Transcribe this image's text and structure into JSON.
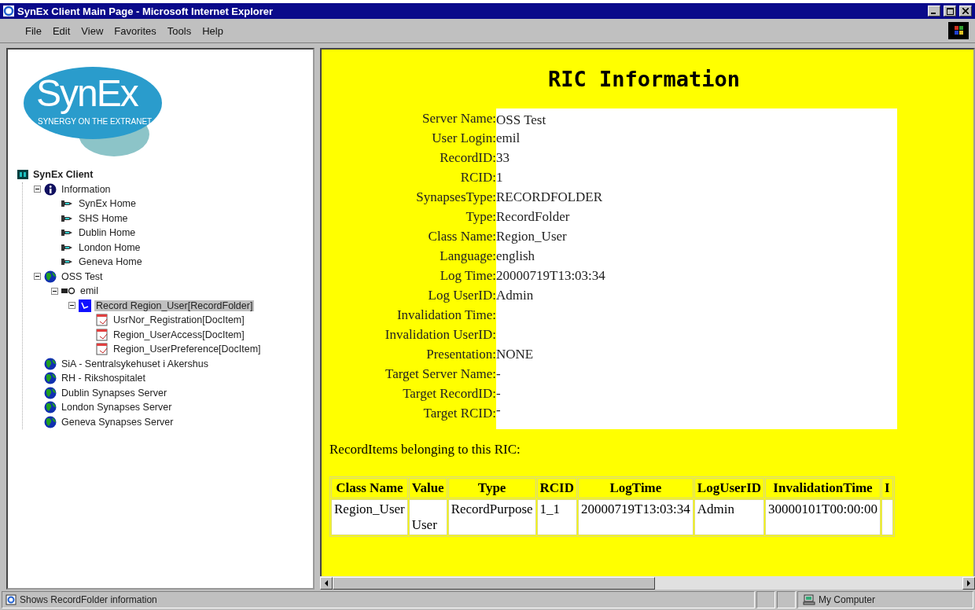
{
  "window": {
    "title": "SynEx Client Main Page - Microsoft Internet Explorer"
  },
  "menu": [
    "File",
    "Edit",
    "View",
    "Favorites",
    "Tools",
    "Help"
  ],
  "logo": {
    "name": "SynEx",
    "tagline": "SYNERGY ON THE EXTRANET"
  },
  "tree": {
    "label": "SynEx Client",
    "kind": "app",
    "children": [
      {
        "label": "Information",
        "kind": "info",
        "expanded": true,
        "selected": false,
        "children": [
          {
            "label": "SynEx Home",
            "kind": "link",
            "selected": false
          },
          {
            "label": "SHS Home",
            "kind": "link",
            "selected": false
          },
          {
            "label": "Dublin Home",
            "kind": "link",
            "selected": false
          },
          {
            "label": "London Home",
            "kind": "link",
            "selected": false
          },
          {
            "label": "Geneva Home",
            "kind": "link",
            "selected": false
          }
        ]
      },
      {
        "label": "OSS Test",
        "kind": "globe",
        "expanded": true,
        "selected": false,
        "children": [
          {
            "label": "emil",
            "kind": "user",
            "expanded": true,
            "selected": false,
            "children": [
              {
                "label": "Record Region_User[RecordFolder]",
                "kind": "folder",
                "expanded": true,
                "selected": true,
                "children": [
                  {
                    "label": "UsrNor_Registration[DocItem]",
                    "kind": "doc",
                    "selected": false
                  },
                  {
                    "label": "Region_UserAccess[DocItem]",
                    "kind": "doc",
                    "selected": false
                  },
                  {
                    "label": "Region_UserPreference[DocItem]",
                    "kind": "doc",
                    "selected": false
                  }
                ]
              }
            ]
          }
        ]
      },
      {
        "label": "SiA - Sentralsykehuset i Akershus",
        "kind": "globe",
        "selected": false
      },
      {
        "label": "RH - Rikshospitalet",
        "kind": "globe",
        "selected": false
      },
      {
        "label": "Dublin Synapses Server",
        "kind": "globe",
        "selected": false
      },
      {
        "label": "London Synapses Server",
        "kind": "globe",
        "selected": false
      },
      {
        "label": "Geneva Synapses Server",
        "kind": "globe",
        "selected": false
      }
    ]
  },
  "content": {
    "title": "RIC Information",
    "fields": [
      {
        "label": "Server Name:",
        "value": "OSS Test"
      },
      {
        "label": "User Login:",
        "value": "emil"
      },
      {
        "label": "RecordID:",
        "value": "33"
      },
      {
        "label": "RCID:",
        "value": "1"
      },
      {
        "label": "SynapsesType:",
        "value": "RECORDFOLDER"
      },
      {
        "label": "Type:",
        "value": "RecordFolder"
      },
      {
        "label": "Class Name:",
        "value": "Region_User"
      },
      {
        "label": "Language:",
        "value": "english"
      },
      {
        "label": "Log Time:",
        "value": "20000719T13:03:34"
      },
      {
        "label": "Log UserID:",
        "value": "Admin"
      },
      {
        "label": "Invalidation Time:"
      },
      {
        "label": "Invalidation UserID:"
      },
      {
        "label": "Presentation:",
        "value": "NONE"
      },
      {
        "label": "Target Server Name:",
        "value": "-"
      },
      {
        "label": "Target RecordID:",
        "value": "-"
      },
      {
        "label": "Target RCID:",
        "value": "-"
      }
    ],
    "items_caption": "RecordItems belonging to this RIC:",
    "table": {
      "columns": [
        "Class Name",
        "Value",
        "Type",
        "RCID",
        "LogTime",
        "LogUserID",
        "InvalidationTime",
        "I"
      ],
      "rows": [
        [
          "Region_User",
          "User",
          "RecordPurpose",
          "1_1",
          "20000719T13:03:34",
          "Admin",
          "30000101T00:00:00"
        ]
      ]
    }
  },
  "status_bar": {
    "text": "Shows RecordFolder information",
    "zone": "My Computer"
  }
}
